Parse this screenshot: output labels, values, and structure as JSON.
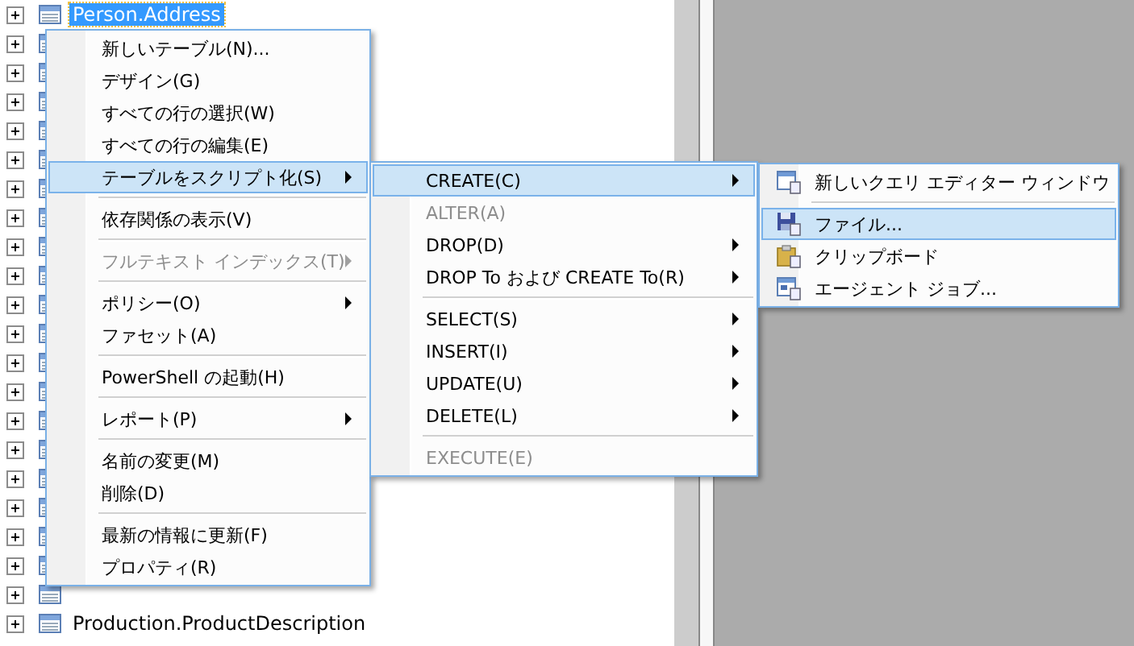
{
  "tree": {
    "rows": [
      {
        "kind": "table",
        "label": "Person.Address",
        "selected": true
      },
      {
        "kind": "table"
      },
      {
        "kind": "table"
      },
      {
        "kind": "table"
      },
      {
        "kind": "table"
      },
      {
        "kind": "table"
      },
      {
        "kind": "table"
      },
      {
        "kind": "table"
      },
      {
        "kind": "table"
      },
      {
        "kind": "table"
      },
      {
        "kind": "table"
      },
      {
        "kind": "table"
      },
      {
        "kind": "table"
      },
      {
        "kind": "table"
      },
      {
        "kind": "table"
      },
      {
        "kind": "table"
      },
      {
        "kind": "table"
      },
      {
        "kind": "table"
      },
      {
        "kind": "table"
      },
      {
        "kind": "table"
      },
      {
        "kind": "table"
      },
      {
        "kind": "table",
        "label": "Production.ProductDescription",
        "selected": false
      }
    ]
  },
  "menus": [
    {
      "items": [
        {
          "kind": "item",
          "label": "新しいテーブル(N)...",
          "selected": false,
          "disabled": false,
          "submenu": false
        },
        {
          "kind": "item",
          "label": "デザイン(G)",
          "selected": false,
          "disabled": false,
          "submenu": false
        },
        {
          "kind": "item",
          "label": "すべての行の選択(W)",
          "selected": false,
          "disabled": false,
          "submenu": false
        },
        {
          "kind": "item",
          "label": "すべての行の編集(E)",
          "selected": false,
          "disabled": false,
          "submenu": false
        },
        {
          "kind": "item",
          "label": "テーブルをスクリプト化(S)",
          "selected": true,
          "disabled": false,
          "submenu": true
        },
        {
          "kind": "separator"
        },
        {
          "kind": "item",
          "label": "依存関係の表示(V)",
          "selected": false,
          "disabled": false,
          "submenu": false
        },
        {
          "kind": "separator"
        },
        {
          "kind": "item",
          "label": "フルテキスト インデックス(T)",
          "selected": false,
          "disabled": true,
          "submenu": true
        },
        {
          "kind": "separator"
        },
        {
          "kind": "item",
          "label": "ポリシー(O)",
          "selected": false,
          "disabled": false,
          "submenu": true
        },
        {
          "kind": "item",
          "label": "ファセット(A)",
          "selected": false,
          "disabled": false,
          "submenu": false
        },
        {
          "kind": "separator"
        },
        {
          "kind": "item",
          "label": "PowerShell の起動(H)",
          "selected": false,
          "disabled": false,
          "submenu": false
        },
        {
          "kind": "separator"
        },
        {
          "kind": "item",
          "label": "レポート(P)",
          "selected": false,
          "disabled": false,
          "submenu": true
        },
        {
          "kind": "separator"
        },
        {
          "kind": "item",
          "label": "名前の変更(M)",
          "selected": false,
          "disabled": false,
          "submenu": false
        },
        {
          "kind": "item",
          "label": "削除(D)",
          "selected": false,
          "disabled": false,
          "submenu": false
        },
        {
          "kind": "separator"
        },
        {
          "kind": "item",
          "label": "最新の情報に更新(F)",
          "selected": false,
          "disabled": false,
          "submenu": false
        },
        {
          "kind": "item",
          "label": "プロパティ(R)",
          "selected": false,
          "disabled": false,
          "submenu": false
        }
      ]
    },
    {
      "items": [
        {
          "kind": "item",
          "label": "CREATE(C)",
          "selected": true,
          "disabled": false,
          "submenu": true
        },
        {
          "kind": "item",
          "label": "ALTER(A)",
          "selected": false,
          "disabled": true,
          "submenu": false
        },
        {
          "kind": "item",
          "label": "DROP(D)",
          "selected": false,
          "disabled": false,
          "submenu": true
        },
        {
          "kind": "item",
          "label": "DROP To および CREATE To(R)",
          "selected": false,
          "disabled": false,
          "submenu": true
        },
        {
          "kind": "separator"
        },
        {
          "kind": "item",
          "label": "SELECT(S)",
          "selected": false,
          "disabled": false,
          "submenu": true
        },
        {
          "kind": "item",
          "label": "INSERT(I)",
          "selected": false,
          "disabled": false,
          "submenu": true
        },
        {
          "kind": "item",
          "label": "UPDATE(U)",
          "selected": false,
          "disabled": false,
          "submenu": true
        },
        {
          "kind": "item",
          "label": "DELETE(L)",
          "selected": false,
          "disabled": false,
          "submenu": true
        },
        {
          "kind": "separator"
        },
        {
          "kind": "item",
          "label": "EXECUTE(E)",
          "selected": false,
          "disabled": true,
          "submenu": false
        }
      ]
    },
    {
      "items": [
        {
          "kind": "item",
          "label": "新しいクエリ エディター ウィンドウ",
          "selected": false,
          "disabled": false,
          "submenu": false
        },
        {
          "kind": "separator"
        },
        {
          "kind": "item",
          "label": "ファイル...",
          "selected": true,
          "disabled": false,
          "submenu": false
        },
        {
          "kind": "item",
          "label": "クリップボード",
          "selected": false,
          "disabled": false,
          "submenu": false
        },
        {
          "kind": "item",
          "label": "エージェント ジョブ...",
          "selected": false,
          "disabled": false,
          "submenu": false
        }
      ]
    }
  ]
}
